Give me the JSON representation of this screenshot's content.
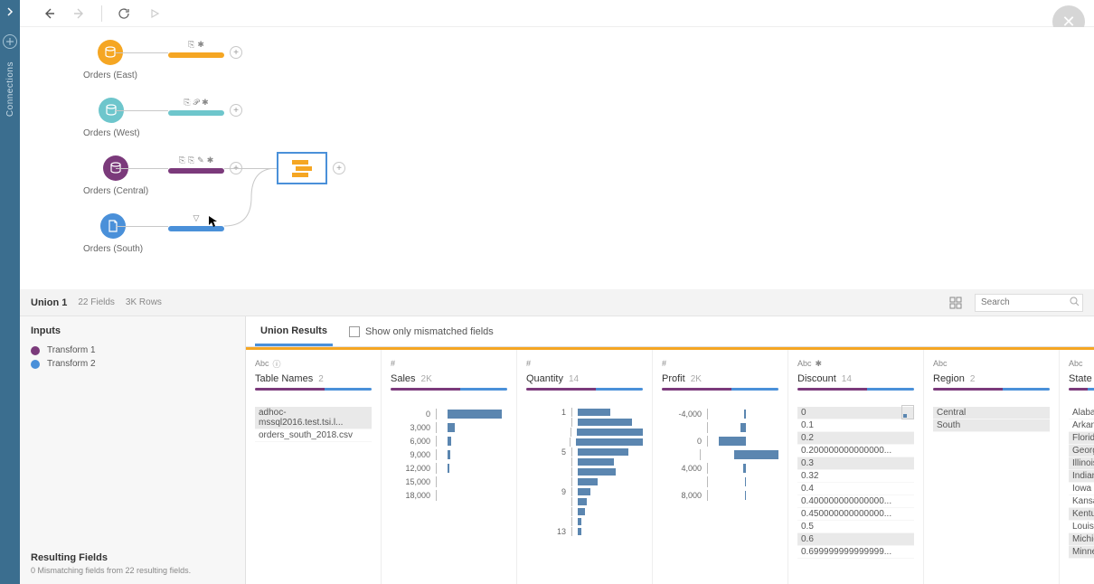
{
  "toolbar": {},
  "left_rail": {
    "label": "Connections"
  },
  "close_label": "✕",
  "flow": {
    "nodes": [
      {
        "id": "east",
        "label": "Orders (East)",
        "color": "#f5a623",
        "icon": "db"
      },
      {
        "id": "west",
        "label": "Orders (West)",
        "color": "#6ec6cc",
        "icon": "db"
      },
      {
        "id": "central",
        "label": "Orders (Central)",
        "color": "#7b3a7b",
        "icon": "db"
      },
      {
        "id": "south",
        "label": "Orders (South)",
        "color": "#4a90d9",
        "icon": "file"
      }
    ],
    "union": {
      "label": "Union 1"
    }
  },
  "panel": {
    "title": "Union 1",
    "fields_meta": "22 Fields",
    "rows_meta": "3K Rows",
    "search_placeholder": "Search",
    "inputs_title": "Inputs",
    "inputs": [
      {
        "label": "Transform 1",
        "color": "#7b3a7b"
      },
      {
        "label": "Transform 2",
        "color": "#4a90d9"
      }
    ],
    "resulting_title": "Resulting Fields",
    "resulting_sub": "0 Mismatching fields from 22 resulting fields.",
    "tab_label": "Union Results",
    "checkbox_label": "Show only mismatched fields"
  },
  "cards": {
    "table_names": {
      "type": "Abc",
      "title": "Table Names",
      "count": "2",
      "values": [
        "adhoc-mssql2016.test.tsi.l...",
        "orders_south_2018.csv"
      ]
    },
    "sales": {
      "type": "#",
      "title": "Sales",
      "count": "2K",
      "labels": [
        "0",
        "3,000",
        "6,000",
        "9,000",
        "12,000",
        "15,000",
        "18,000"
      ],
      "bars": [
        60,
        8,
        4,
        3,
        2,
        0,
        0
      ]
    },
    "quantity": {
      "type": "#",
      "title": "Quantity",
      "count": "14",
      "labels": [
        "1",
        "",
        "",
        "",
        "5",
        "",
        "",
        "",
        "9",
        "",
        "",
        "",
        "13"
      ],
      "bars": [
        36,
        60,
        74,
        78,
        56,
        40,
        42,
        22,
        14,
        10,
        8,
        4,
        4
      ]
    },
    "profit": {
      "type": "#",
      "title": "Profit",
      "count": "2K",
      "labels": [
        "-4,000",
        "",
        "0",
        "",
        "4,000",
        "",
        "8,000"
      ],
      "bars": [
        2,
        6,
        90,
        10,
        3,
        1,
        1
      ],
      "offsets": [
        28,
        24,
        0,
        30,
        27,
        29,
        29
      ],
      "widths": [
        2,
        6,
        30,
        60,
        3,
        1,
        1
      ]
    },
    "discount": {
      "type": "Abc",
      "title": "Discount",
      "count": "14",
      "values": [
        {
          "v": "0",
          "hl": true
        },
        {
          "v": "0.1",
          "hl": false
        },
        {
          "v": "0.2",
          "hl": true
        },
        {
          "v": "0.200000000000000...",
          "hl": false
        },
        {
          "v": "0.3",
          "hl": true
        },
        {
          "v": "0.32",
          "hl": false
        },
        {
          "v": "0.4",
          "hl": false
        },
        {
          "v": "0.400000000000000...",
          "hl": false
        },
        {
          "v": "0.450000000000000...",
          "hl": false
        },
        {
          "v": "0.5",
          "hl": false
        },
        {
          "v": "0.6",
          "hl": true
        },
        {
          "v": "0.699999999999999...",
          "hl": false
        }
      ]
    },
    "region": {
      "type": "Abc",
      "title": "Region",
      "count": "2",
      "values": [
        {
          "v": "Central",
          "hl": true
        },
        {
          "v": "South",
          "hl": true
        }
      ]
    },
    "state": {
      "type": "Abc",
      "title": "State",
      "values": [
        {
          "v": "Alabam",
          "hl": false
        },
        {
          "v": "Arkans",
          "hl": false
        },
        {
          "v": "Florida",
          "hl": true
        },
        {
          "v": "Georgi",
          "hl": true
        },
        {
          "v": "Illinois",
          "hl": true
        },
        {
          "v": "Indiana",
          "hl": true
        },
        {
          "v": "Iowa",
          "hl": false
        },
        {
          "v": "Kansas",
          "hl": false
        },
        {
          "v": "Kentuc",
          "hl": true
        },
        {
          "v": "Louisia",
          "hl": false
        },
        {
          "v": "Michig",
          "hl": true
        },
        {
          "v": "Minnes",
          "hl": true
        }
      ]
    }
  }
}
